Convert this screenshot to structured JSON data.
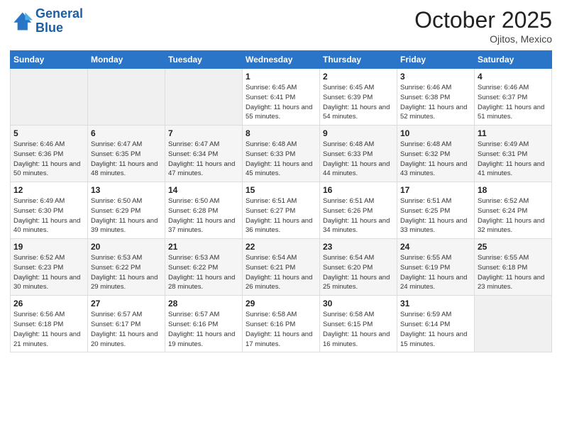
{
  "header": {
    "logo_line1": "General",
    "logo_line2": "Blue",
    "month": "October 2025",
    "location": "Ojitos, Mexico"
  },
  "days_of_week": [
    "Sunday",
    "Monday",
    "Tuesday",
    "Wednesday",
    "Thursday",
    "Friday",
    "Saturday"
  ],
  "weeks": [
    [
      {
        "day": "",
        "info": ""
      },
      {
        "day": "",
        "info": ""
      },
      {
        "day": "",
        "info": ""
      },
      {
        "day": "1",
        "info": "Sunrise: 6:45 AM\nSunset: 6:41 PM\nDaylight: 11 hours\nand 55 minutes."
      },
      {
        "day": "2",
        "info": "Sunrise: 6:45 AM\nSunset: 6:39 PM\nDaylight: 11 hours\nand 54 minutes."
      },
      {
        "day": "3",
        "info": "Sunrise: 6:46 AM\nSunset: 6:38 PM\nDaylight: 11 hours\nand 52 minutes."
      },
      {
        "day": "4",
        "info": "Sunrise: 6:46 AM\nSunset: 6:37 PM\nDaylight: 11 hours\nand 51 minutes."
      }
    ],
    [
      {
        "day": "5",
        "info": "Sunrise: 6:46 AM\nSunset: 6:36 PM\nDaylight: 11 hours\nand 50 minutes."
      },
      {
        "day": "6",
        "info": "Sunrise: 6:47 AM\nSunset: 6:35 PM\nDaylight: 11 hours\nand 48 minutes."
      },
      {
        "day": "7",
        "info": "Sunrise: 6:47 AM\nSunset: 6:34 PM\nDaylight: 11 hours\nand 47 minutes."
      },
      {
        "day": "8",
        "info": "Sunrise: 6:48 AM\nSunset: 6:33 PM\nDaylight: 11 hours\nand 45 minutes."
      },
      {
        "day": "9",
        "info": "Sunrise: 6:48 AM\nSunset: 6:33 PM\nDaylight: 11 hours\nand 44 minutes."
      },
      {
        "day": "10",
        "info": "Sunrise: 6:48 AM\nSunset: 6:32 PM\nDaylight: 11 hours\nand 43 minutes."
      },
      {
        "day": "11",
        "info": "Sunrise: 6:49 AM\nSunset: 6:31 PM\nDaylight: 11 hours\nand 41 minutes."
      }
    ],
    [
      {
        "day": "12",
        "info": "Sunrise: 6:49 AM\nSunset: 6:30 PM\nDaylight: 11 hours\nand 40 minutes."
      },
      {
        "day": "13",
        "info": "Sunrise: 6:50 AM\nSunset: 6:29 PM\nDaylight: 11 hours\nand 39 minutes."
      },
      {
        "day": "14",
        "info": "Sunrise: 6:50 AM\nSunset: 6:28 PM\nDaylight: 11 hours\nand 37 minutes."
      },
      {
        "day": "15",
        "info": "Sunrise: 6:51 AM\nSunset: 6:27 PM\nDaylight: 11 hours\nand 36 minutes."
      },
      {
        "day": "16",
        "info": "Sunrise: 6:51 AM\nSunset: 6:26 PM\nDaylight: 11 hours\nand 34 minutes."
      },
      {
        "day": "17",
        "info": "Sunrise: 6:51 AM\nSunset: 6:25 PM\nDaylight: 11 hours\nand 33 minutes."
      },
      {
        "day": "18",
        "info": "Sunrise: 6:52 AM\nSunset: 6:24 PM\nDaylight: 11 hours\nand 32 minutes."
      }
    ],
    [
      {
        "day": "19",
        "info": "Sunrise: 6:52 AM\nSunset: 6:23 PM\nDaylight: 11 hours\nand 30 minutes."
      },
      {
        "day": "20",
        "info": "Sunrise: 6:53 AM\nSunset: 6:22 PM\nDaylight: 11 hours\nand 29 minutes."
      },
      {
        "day": "21",
        "info": "Sunrise: 6:53 AM\nSunset: 6:22 PM\nDaylight: 11 hours\nand 28 minutes."
      },
      {
        "day": "22",
        "info": "Sunrise: 6:54 AM\nSunset: 6:21 PM\nDaylight: 11 hours\nand 26 minutes."
      },
      {
        "day": "23",
        "info": "Sunrise: 6:54 AM\nSunset: 6:20 PM\nDaylight: 11 hours\nand 25 minutes."
      },
      {
        "day": "24",
        "info": "Sunrise: 6:55 AM\nSunset: 6:19 PM\nDaylight: 11 hours\nand 24 minutes."
      },
      {
        "day": "25",
        "info": "Sunrise: 6:55 AM\nSunset: 6:18 PM\nDaylight: 11 hours\nand 23 minutes."
      }
    ],
    [
      {
        "day": "26",
        "info": "Sunrise: 6:56 AM\nSunset: 6:18 PM\nDaylight: 11 hours\nand 21 minutes."
      },
      {
        "day": "27",
        "info": "Sunrise: 6:57 AM\nSunset: 6:17 PM\nDaylight: 11 hours\nand 20 minutes."
      },
      {
        "day": "28",
        "info": "Sunrise: 6:57 AM\nSunset: 6:16 PM\nDaylight: 11 hours\nand 19 minutes."
      },
      {
        "day": "29",
        "info": "Sunrise: 6:58 AM\nSunset: 6:16 PM\nDaylight: 11 hours\nand 17 minutes."
      },
      {
        "day": "30",
        "info": "Sunrise: 6:58 AM\nSunset: 6:15 PM\nDaylight: 11 hours\nand 16 minutes."
      },
      {
        "day": "31",
        "info": "Sunrise: 6:59 AM\nSunset: 6:14 PM\nDaylight: 11 hours\nand 15 minutes."
      },
      {
        "day": "",
        "info": ""
      }
    ]
  ]
}
